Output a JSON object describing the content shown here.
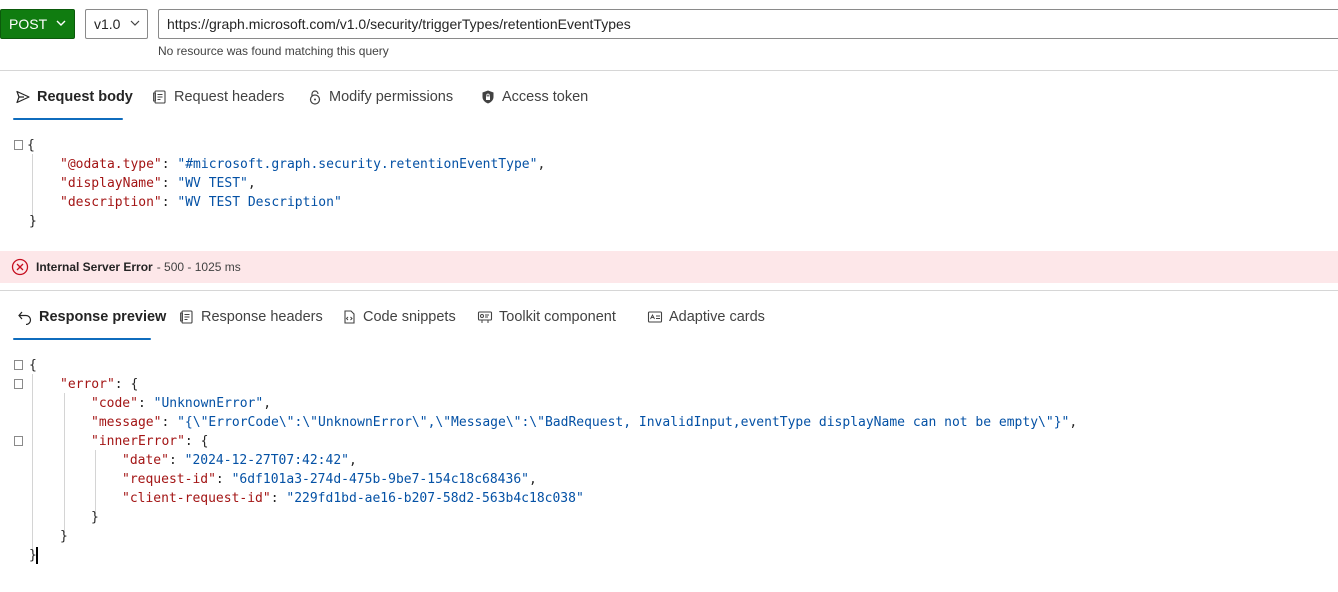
{
  "toolbar": {
    "method": "POST",
    "version": "v1.0",
    "url": "https://graph.microsoft.com/v1.0/security/triggerTypes/retentionEventTypes",
    "url_hint": "No resource was found matching this query"
  },
  "request_tabs": [
    {
      "label": "Request body",
      "icon": "send-icon",
      "active": true
    },
    {
      "label": "Request headers",
      "icon": "document-icon"
    },
    {
      "label": "Modify permissions",
      "icon": "lock-open-icon"
    },
    {
      "label": "Access token",
      "icon": "shield-lock-icon"
    }
  ],
  "request_body": {
    "open": "{",
    "lines": [
      {
        "key": "\"@odata.type\"",
        "value": "\"#microsoft.graph.security.retentionEventType\"",
        "trail": ","
      },
      {
        "key": "\"displayName\"",
        "value": "\"WV TEST\"",
        "trail": ","
      },
      {
        "key": "\"description\"",
        "value": "\"WV TEST Description\"",
        "trail": ""
      }
    ],
    "close": "}"
  },
  "status": {
    "label": "Internal Server Error",
    "meta": "- 500 - 1025 ms",
    "color": "#c50f1f",
    "background": "#fde7e9"
  },
  "response_tabs": [
    {
      "label": "Response preview",
      "icon": "undo-arrow-icon",
      "active": true
    },
    {
      "label": "Response headers",
      "icon": "document-icon"
    },
    {
      "label": "Code snippets",
      "icon": "code-document-icon"
    },
    {
      "label": "Toolkit component",
      "icon": "toolkit-icon"
    },
    {
      "label": "Adaptive cards",
      "icon": "card-icon"
    }
  ],
  "response_body": {
    "open": "{",
    "error_key": "\"error\"",
    "error_open": "{",
    "code_key": "\"code\"",
    "code_value": "\"UnknownError\"",
    "message_key": "\"message\"",
    "message_value": "\"{\\\"ErrorCode\\\":\\\"UnknownError\\\",\\\"Message\\\":\\\"BadRequest, InvalidInput,eventType displayName can not be empty\\\"}\"",
    "inner_key": "\"innerError\"",
    "inner_open": "{",
    "date_key": "\"date\"",
    "date_value": "\"2024-12-27T07:42:42\"",
    "reqid_key": "\"request-id\"",
    "reqid_value": "\"6df101a3-274d-475b-9be7-154c18c68436\"",
    "creqid_key": "\"client-request-id\"",
    "creqid_value": "\"229fd1bd-ae16-b207-58d2-563b4c18c038\"",
    "inner_close": "}",
    "error_close": "}",
    "close": "}"
  },
  "colors": {
    "accent": "#0f6cbd",
    "method_bg": "#107c10",
    "json_key": "#a31515",
    "json_string": "#0451a5"
  }
}
